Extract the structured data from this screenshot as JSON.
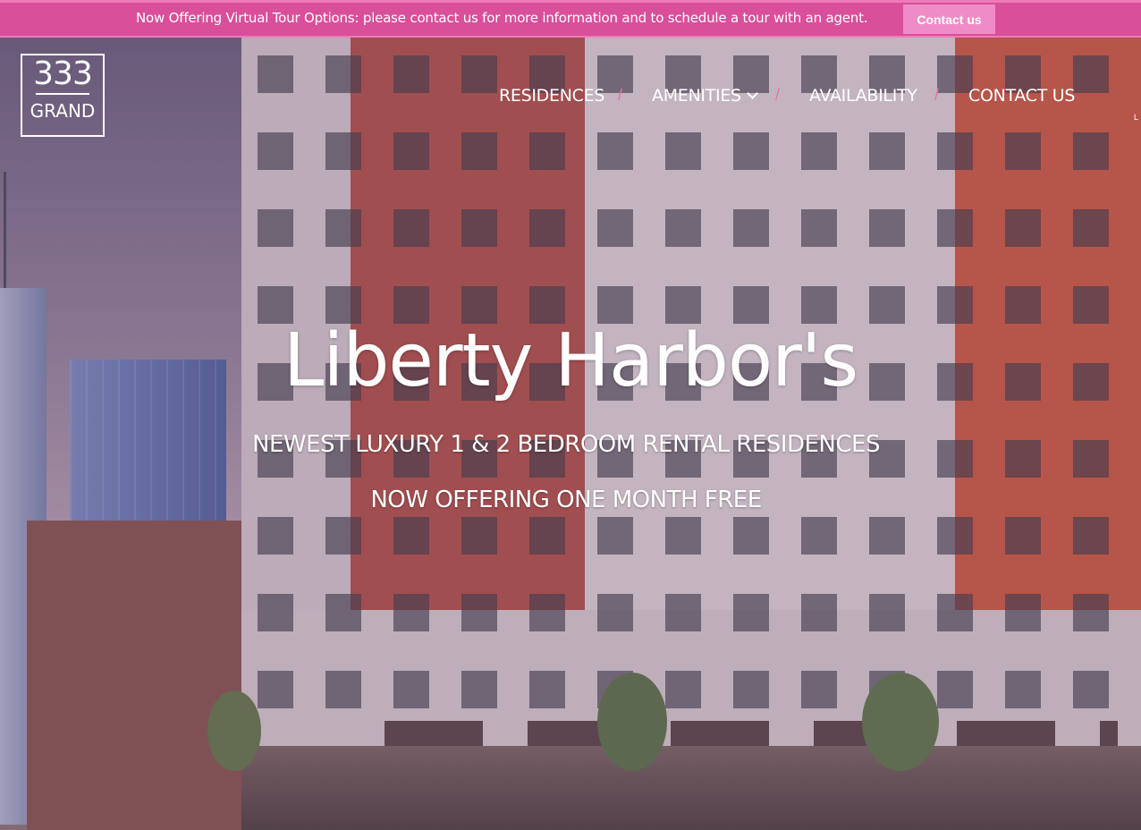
{
  "announcement": {
    "text": "Now Offering Virtual Tour Options: please contact us for more information and to schedule a tour with an agent.",
    "button_label": "Contact us"
  },
  "logo": {
    "number": "333",
    "word": "GRAND"
  },
  "nav": {
    "items": [
      {
        "label": "RESIDENCES"
      },
      {
        "label": "AMENITIES",
        "has_dropdown": true
      },
      {
        "label": "AVAILABILITY"
      },
      {
        "label": "CONTACT US"
      }
    ],
    "separator": "/",
    "edge_text": "L"
  },
  "hero": {
    "title": "Liberty Harbor's",
    "subtitle": "NEWEST LUXURY 1 & 2 BEDROOM RENTAL RESIDENCES",
    "offer": "NOW OFFERING ONE MONTH FREE"
  },
  "colors": {
    "announcement_bg": "#d94f9a",
    "button_bg": "#ef8cc6",
    "nav_separator": "#e8709f",
    "text": "#ffffff"
  }
}
